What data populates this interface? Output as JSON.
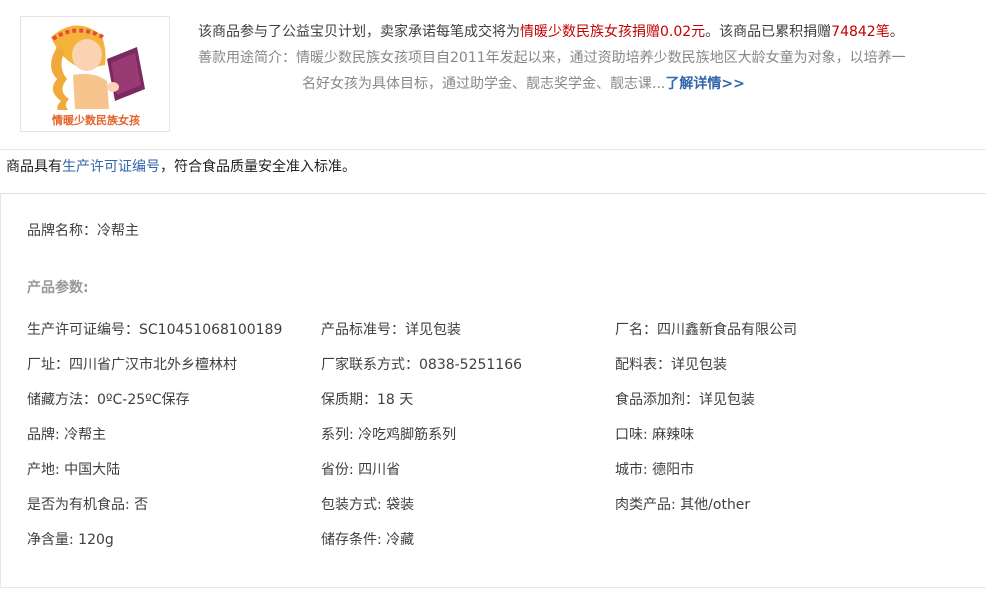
{
  "charity": {
    "logo_caption": "情暖少数民族女孩",
    "line1_prefix": "该商品参与了公益宝贝计划，卖家承诺每笔成交将为",
    "project_name": "情暖少数民族女孩",
    "donate_label": "捐赠",
    "donate_amount": "0.02元",
    "line1_mid": "。该商品已累积捐赠",
    "total_count": "74842笔",
    "line1_end": "。",
    "intro_label": "善款用途简介：",
    "intro_line1": "情暖少数民族女孩项目自2011年发起以来，通过资助培养少数民族地区大龄女童为对象，以培养一",
    "intro_line2": "名好女孩为具体目标，通过助学金、靓志奖学金、靓志课...",
    "more_link": "了解详情>>"
  },
  "license": {
    "prefix": "商品具有",
    "link": "生产许可证编号",
    "suffix": "，符合食品质量安全准入标准。"
  },
  "params": {
    "brand_line": "品牌名称：冷帮主",
    "section_title": "产品参数:",
    "items": [
      "生产许可证编号：SC10451068100189",
      "产品标准号：详见包装",
      "厂名：四川鑫新食品有限公司",
      "厂址：四川省广汉市北外乡檀林村",
      "厂家联系方式：0838-5251166",
      "配料表：详见包装",
      "储藏方法：0ºC-25ºC保存",
      "保质期：18 天",
      "食品添加剂：详见包装",
      "品牌: 冷帮主",
      "系列: 冷吃鸡脚筋系列",
      "口味: 麻辣味",
      "产地: 中国大陆",
      "省份: 四川省",
      "城市: 德阳市",
      "是否为有机食品: 否",
      "包装方式: 袋装",
      "肉类产品: 其他/other",
      "净含量: 120g",
      "储存条件: 冷藏"
    ]
  },
  "colors": {
    "highlight": "#c40000",
    "link": "#3366aa",
    "muted": "#888888"
  }
}
